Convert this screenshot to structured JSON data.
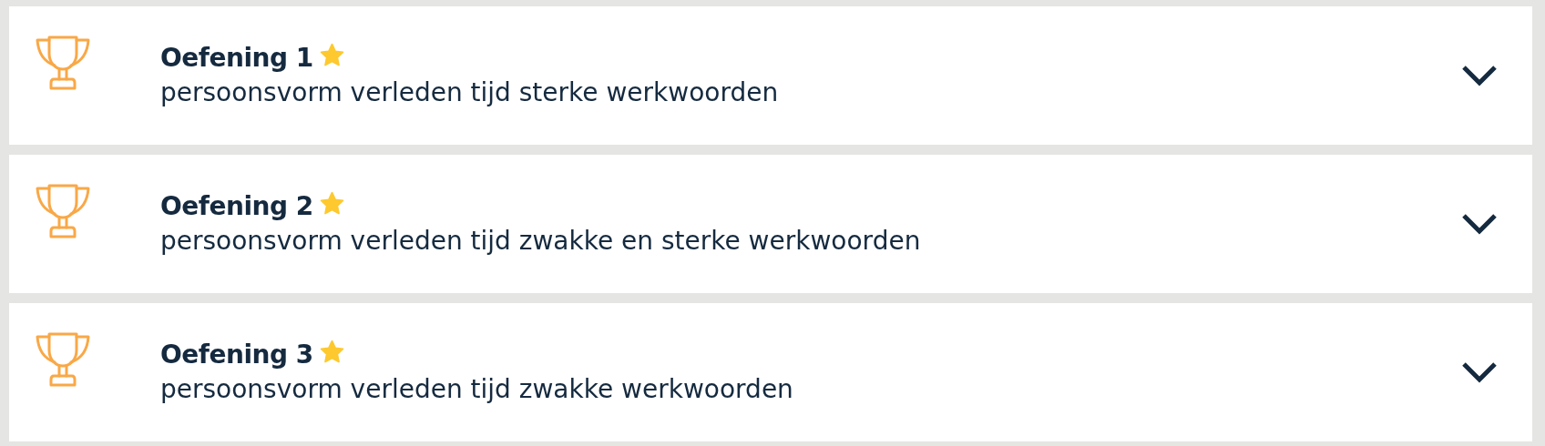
{
  "exercises": [
    {
      "title": "Oefening 1",
      "starred": true,
      "subtitle": "persoonsvorm verleden tijd sterke werkwoorden",
      "expanded": false
    },
    {
      "title": "Oefening 2",
      "starred": true,
      "subtitle": "persoonsvorm verleden tijd zwakke en sterke werkwoorden",
      "expanded": false
    },
    {
      "title": "Oefening 3",
      "starred": true,
      "subtitle": "persoonsvorm verleden tijd zwakke werkwoorden",
      "expanded": false
    }
  ]
}
